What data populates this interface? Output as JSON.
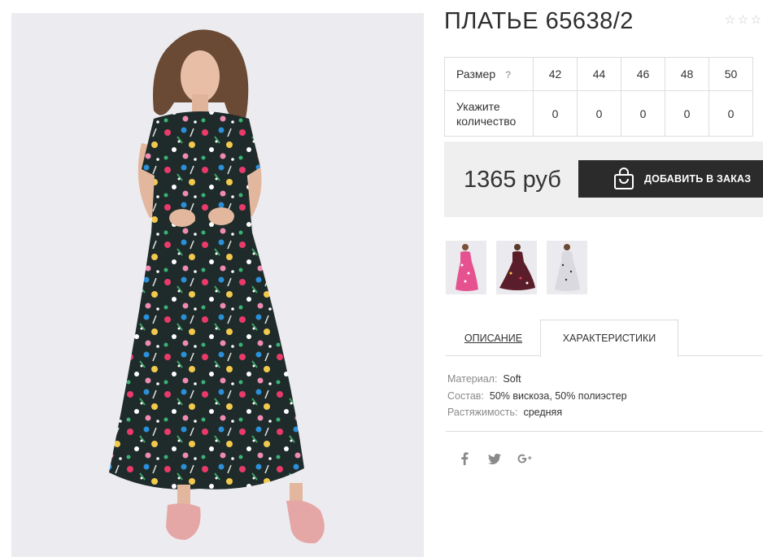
{
  "product": {
    "title": "ПЛАТЬЕ 65638/2",
    "rating": {
      "filled": 0,
      "max": 3
    }
  },
  "sizes_table": {
    "size_label": "Размер",
    "help_mark": "?",
    "qty_label_line1": "Укажите",
    "qty_label_line2": "количество",
    "sizes": [
      "42",
      "44",
      "46",
      "48",
      "50"
    ],
    "quantities": [
      "0",
      "0",
      "0",
      "0",
      "0"
    ]
  },
  "buy": {
    "price": "1365 руб",
    "add_button_label": "ДОБАВИТЬ В ЗАКАЗ",
    "icon": "shopping-bag-icon"
  },
  "thumbnails": [
    {
      "name": "pink-floral-dress"
    },
    {
      "name": "burgundy-floral-dress"
    },
    {
      "name": "white-floral-dress"
    }
  ],
  "tabs": {
    "description": "ОПИСАНИЕ",
    "characteristics": "ХАРАКТЕРИСТИКИ",
    "active": "characteristics"
  },
  "characteristics": [
    {
      "key": "Материал:",
      "value": "Soft"
    },
    {
      "key": "Состав:",
      "value": "50% вискоза, 50% полиэстер"
    },
    {
      "key": "Растяжимость:",
      "value": "средняя"
    }
  ],
  "social": {
    "facebook": "f",
    "twitter": "twitter-icon",
    "googleplus": "g+"
  },
  "colors": {
    "button_bg": "#2b2b2b",
    "buybox_bg": "#efefef",
    "border": "#dddddd",
    "photo_bg": "#ecebef"
  }
}
